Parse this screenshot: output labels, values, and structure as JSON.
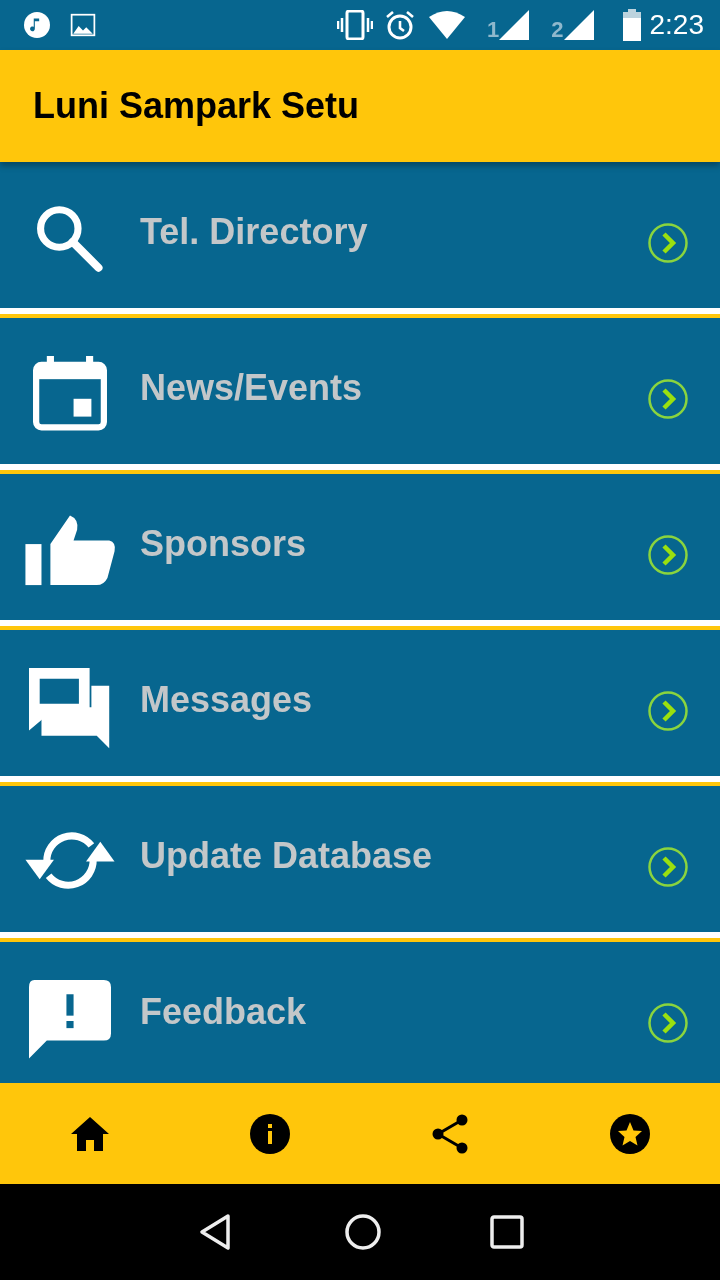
{
  "status_bar": {
    "sim_labels": [
      "1",
      "2"
    ],
    "time": "2:23"
  },
  "app_bar": {
    "title": "Luni Sampark Setu"
  },
  "menu": [
    {
      "label": "Tel. Directory",
      "kind": "search"
    },
    {
      "label": "News/Events",
      "kind": "calendar"
    },
    {
      "label": "Sponsors",
      "kind": "thumb"
    },
    {
      "label": "Messages",
      "kind": "chat"
    },
    {
      "label": "Update Database",
      "kind": "sync"
    },
    {
      "label": "Feedback",
      "kind": "feedback"
    }
  ],
  "bottom_nav": [
    {
      "kind": "home"
    },
    {
      "kind": "info"
    },
    {
      "kind": "share"
    },
    {
      "kind": "star"
    }
  ]
}
